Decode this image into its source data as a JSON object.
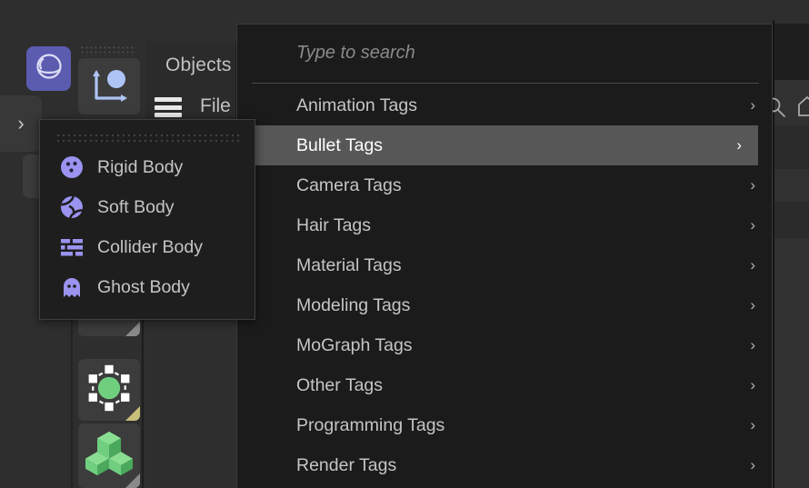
{
  "app": {
    "background_color": "#2e2e2e",
    "menu_background": "#1b1b1b",
    "highlight_color": "#575757",
    "accent_purple": "#9a93f0",
    "accent_green": "#6fcf7f",
    "accent_blue": "#aec4f5"
  },
  "toolbar": {
    "sphere_icon": "sphere-primitive-icon",
    "axis_icon": "axis-object-icon",
    "expand_arrow_label": "›",
    "bracket_label": "[",
    "grip_label": "drag-grip"
  },
  "panel_header": {
    "objects_label": "Objects",
    "file_label": "File",
    "hamburger_icon": "hamburger-menu-icon"
  },
  "right_icons": {
    "search_icon": "search-icon",
    "home_icon": "home-icon"
  },
  "object_buttons": [
    {
      "name": "spline-object-button",
      "icon": "blue-bar-icon"
    },
    {
      "name": "deformer-object-button",
      "icon": "green-sphere-points-icon"
    },
    {
      "name": "mograph-cloner-button",
      "icon": "green-cubes-icon"
    }
  ],
  "main_menu": {
    "search": {
      "placeholder": "Type to search",
      "value": ""
    },
    "items": [
      {
        "label": "Animation Tags",
        "has_submenu": true,
        "selected": false,
        "chevron": "›"
      },
      {
        "label": "Bullet Tags",
        "has_submenu": true,
        "selected": true,
        "chevron": "›"
      },
      {
        "label": "Camera Tags",
        "has_submenu": true,
        "selected": false,
        "chevron": "›"
      },
      {
        "label": "Hair Tags",
        "has_submenu": true,
        "selected": false,
        "chevron": "›"
      },
      {
        "label": "Material Tags",
        "has_submenu": true,
        "selected": false,
        "chevron": "›"
      },
      {
        "label": "Modeling Tags",
        "has_submenu": true,
        "selected": false,
        "chevron": "›"
      },
      {
        "label": "MoGraph Tags",
        "has_submenu": true,
        "selected": false,
        "chevron": "›"
      },
      {
        "label": "Other Tags",
        "has_submenu": true,
        "selected": false,
        "chevron": "›"
      },
      {
        "label": "Programming Tags",
        "has_submenu": true,
        "selected": false,
        "chevron": "›"
      },
      {
        "label": "Render Tags",
        "has_submenu": true,
        "selected": false,
        "chevron": "›"
      }
    ]
  },
  "submenu": {
    "title": "Bullet Tags",
    "items": [
      {
        "label": "Rigid Body",
        "icon": "rigid-body-icon"
      },
      {
        "label": "Soft Body",
        "icon": "soft-body-icon"
      },
      {
        "label": "Collider Body",
        "icon": "collider-body-icon"
      },
      {
        "label": "Ghost Body",
        "icon": "ghost-body-icon"
      }
    ]
  }
}
